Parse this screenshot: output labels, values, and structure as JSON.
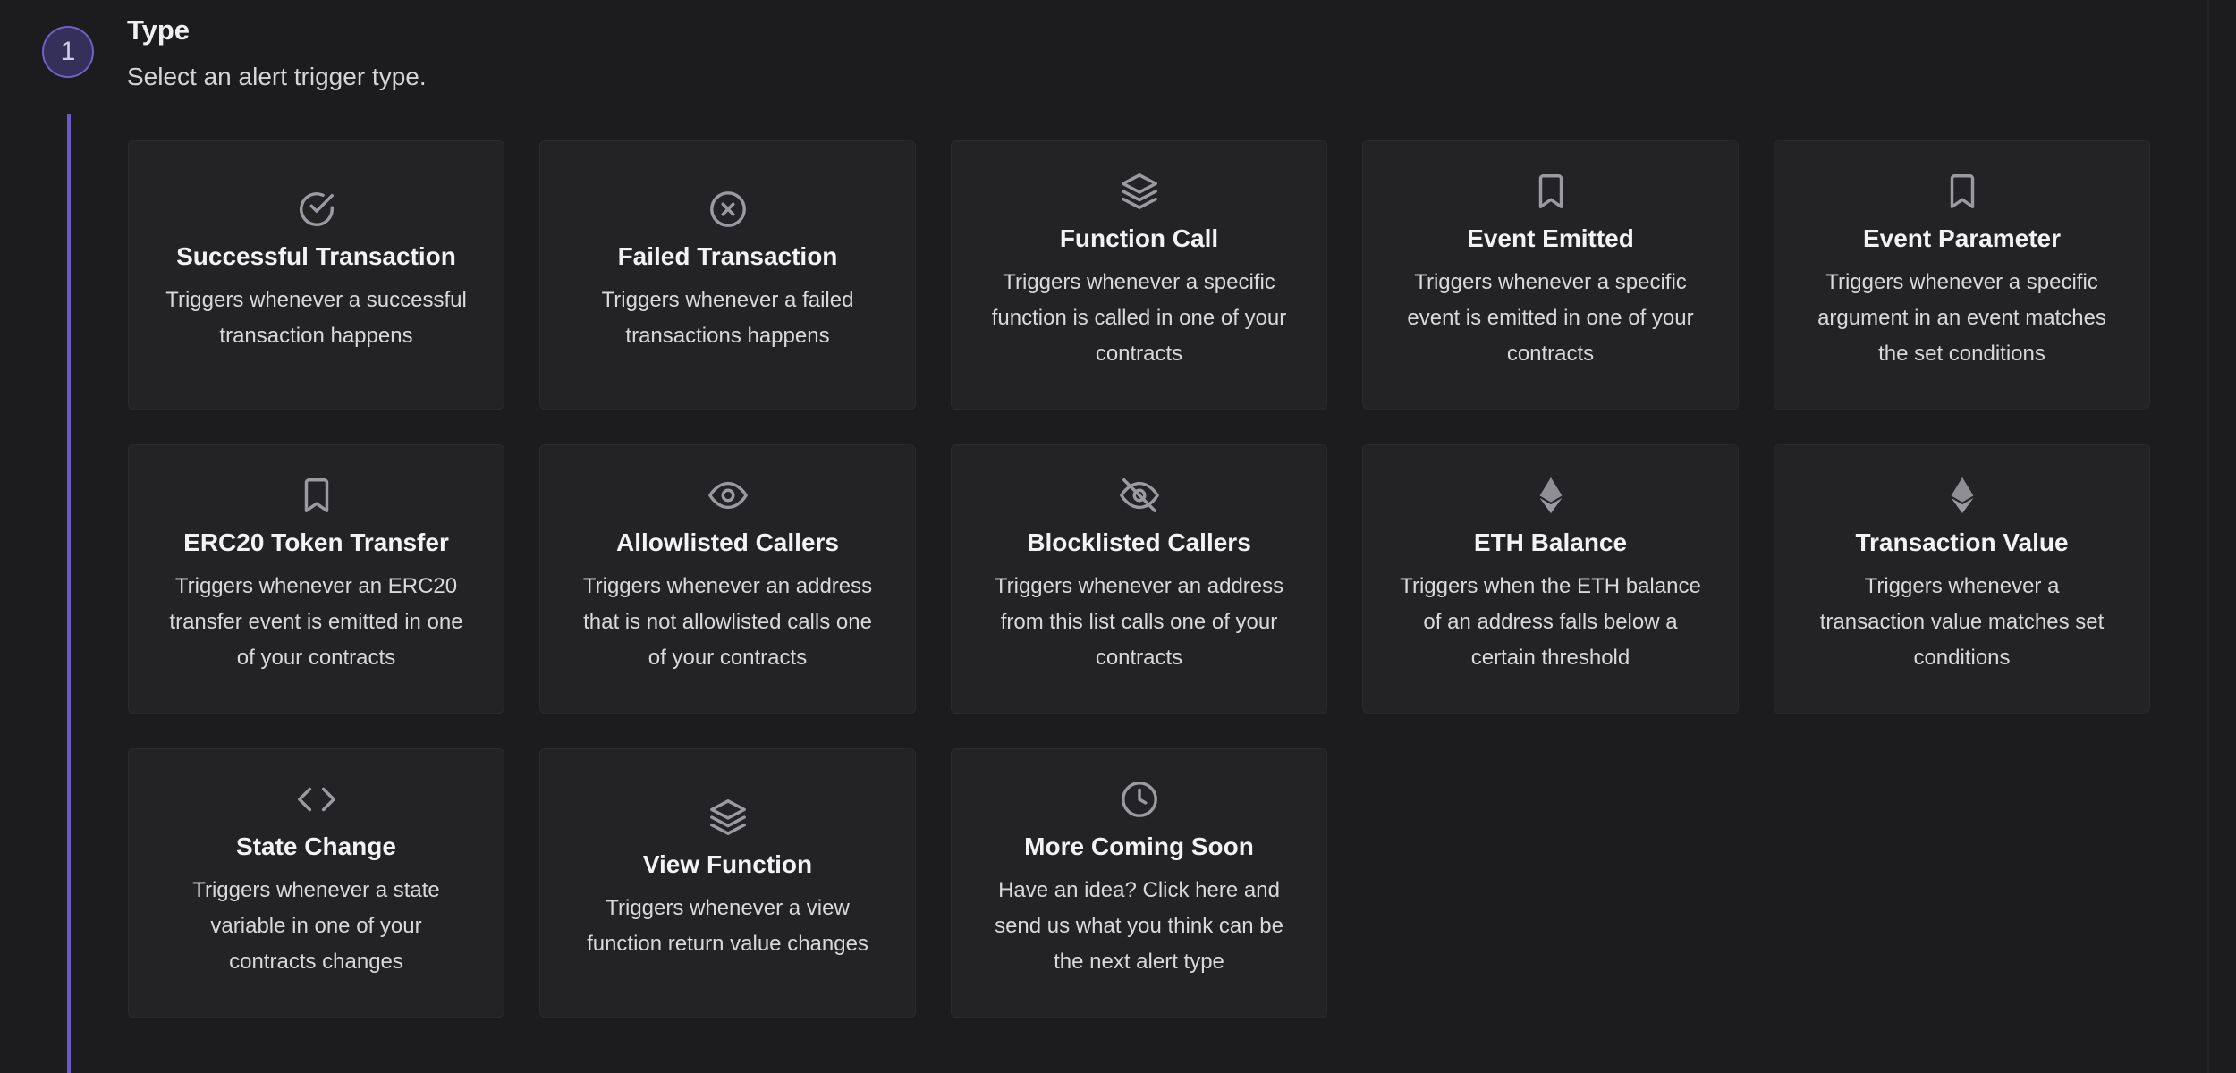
{
  "step": {
    "number": "1",
    "title": "Type",
    "subtitle": "Select an alert trigger type."
  },
  "cards": [
    {
      "icon": "check-circle-icon",
      "title": "Successful Transaction",
      "description": "Triggers whenever a successful transaction happens"
    },
    {
      "icon": "x-circle-icon",
      "title": "Failed Transaction",
      "description": "Triggers whenever a failed transactions happens"
    },
    {
      "icon": "layers-icon",
      "title": "Function Call",
      "description": "Triggers whenever a specific function is called in one of your contracts"
    },
    {
      "icon": "bookmark-icon",
      "title": "Event Emitted",
      "description": "Triggers whenever a specific event is emitted in one of your contracts"
    },
    {
      "icon": "bookmark-icon",
      "title": "Event Parameter",
      "description": "Triggers whenever a specific argument in an event matches the set conditions"
    },
    {
      "icon": "bookmark-icon",
      "title": "ERC20 Token Transfer",
      "description": "Triggers whenever an ERC20 transfer event is emitted in one of your contracts"
    },
    {
      "icon": "eye-icon",
      "title": "Allowlisted Callers",
      "description": "Triggers whenever an address that is not allowlisted calls one of your contracts"
    },
    {
      "icon": "eye-off-icon",
      "title": "Blocklisted Callers",
      "description": "Triggers whenever an address from this list calls one of your contracts"
    },
    {
      "icon": "ethereum-icon",
      "title": "ETH Balance",
      "description": "Triggers when the ETH balance of an address falls below a certain threshold"
    },
    {
      "icon": "ethereum-icon",
      "title": "Transaction Value",
      "description": "Triggers whenever a transaction value matches set conditions"
    },
    {
      "icon": "code-icon",
      "title": "State Change",
      "description": "Triggers whenever a state variable in one of your contracts changes"
    },
    {
      "icon": "layers-icon",
      "title": "View Function",
      "description": "Triggers whenever a view function return value changes"
    },
    {
      "icon": "clock-icon",
      "title": "More Coming Soon",
      "description": "Have an idea? Click here and send us what you think can be the next alert type"
    }
  ]
}
